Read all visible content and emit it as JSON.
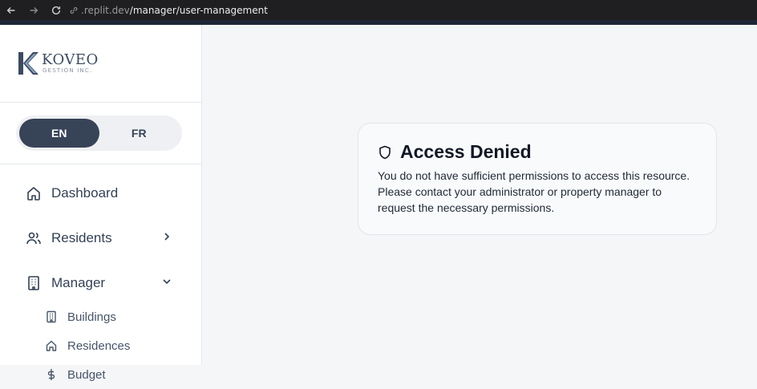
{
  "browser": {
    "url_domain": ".replit.dev",
    "url_path": "/manager/user-management"
  },
  "logo": {
    "name": "KOVEO",
    "subtitle": "GESTION INC."
  },
  "language": {
    "options": [
      "EN",
      "FR"
    ],
    "selected": "EN"
  },
  "sidebar": {
    "items": [
      {
        "label": "Dashboard",
        "icon": "home-icon"
      },
      {
        "label": "Residents",
        "icon": "users-icon"
      },
      {
        "label": "Manager",
        "icon": "building-icon"
      }
    ],
    "manager_subitems": [
      {
        "label": "Buildings",
        "icon": "building-icon"
      },
      {
        "label": "Residences",
        "icon": "home-icon"
      },
      {
        "label": "Budget",
        "icon": "dollar-icon"
      }
    ]
  },
  "main": {
    "title": "Access Denied",
    "message": "You do not have sufficient permissions to access this resource. Please contact your administrator or property manager to request the necessary permissions."
  }
}
